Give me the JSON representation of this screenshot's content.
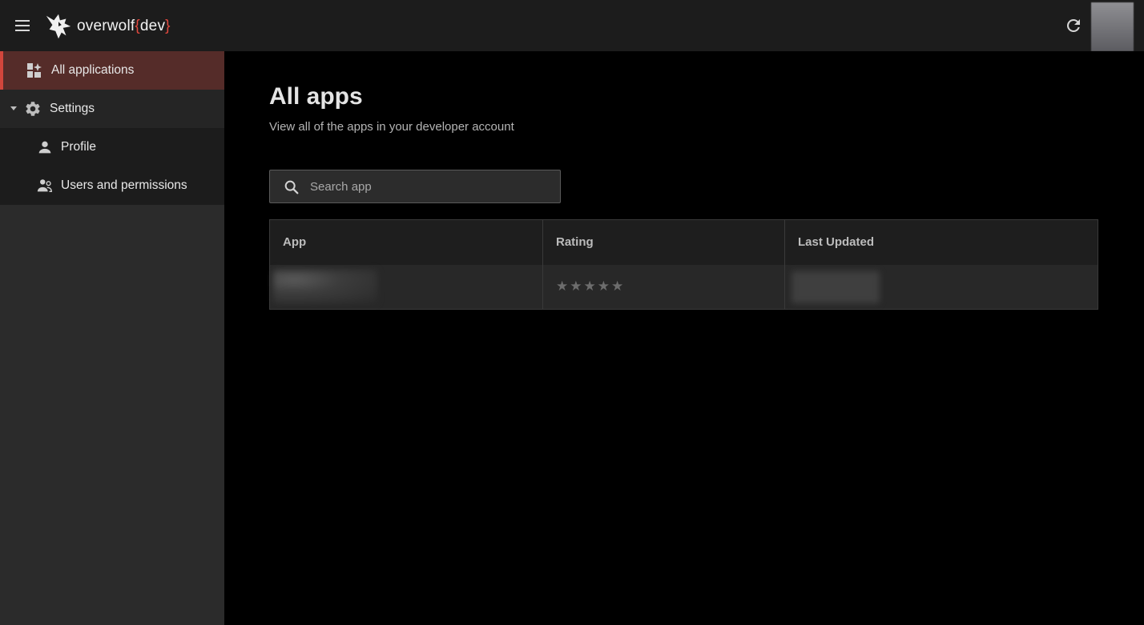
{
  "header": {
    "logo_name": "overwolf",
    "logo_brace_open": "{",
    "logo_suffix": "dev",
    "logo_brace_close": "}",
    "accent_color": "#e0483e",
    "icons": [
      "menu-icon",
      "wolf-logo-icon",
      "refresh-icon",
      "avatar"
    ]
  },
  "sidebar": {
    "items": [
      {
        "label": "All applications",
        "icon": "dashboard-icon",
        "active": true
      },
      {
        "label": "Settings",
        "icon": "gear-icon",
        "expanded": true
      },
      {
        "label": "Profile",
        "icon": "person-icon"
      },
      {
        "label": "Users and permissions",
        "icon": "users-icon"
      }
    ]
  },
  "main": {
    "title": "All apps",
    "subtitle": "View all of the apps in your developer account",
    "search": {
      "placeholder": "Search app",
      "value": ""
    },
    "table": {
      "headers": [
        "App",
        "Rating",
        "Last Updated"
      ],
      "rows": [
        {
          "app": "",
          "rating_stars": 0,
          "rating_max": 5,
          "last_updated": ""
        }
      ]
    }
  }
}
